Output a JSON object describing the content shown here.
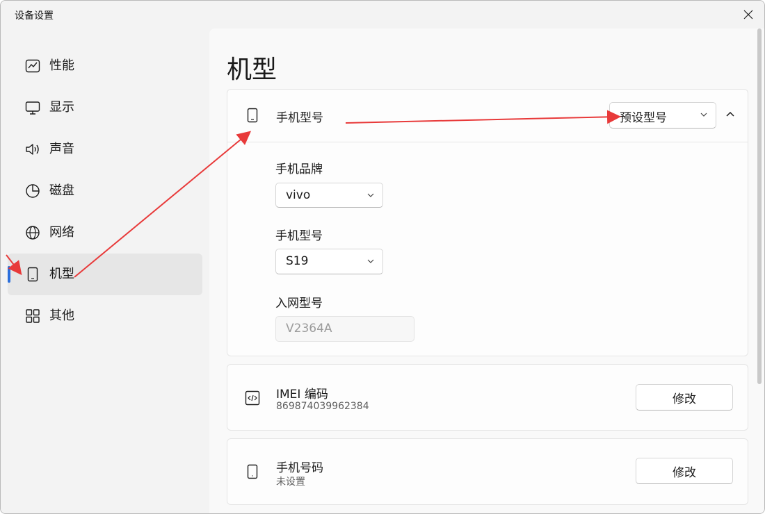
{
  "window": {
    "title": "设备设置"
  },
  "sidebar": {
    "items": [
      {
        "label": "性能",
        "icon": "chart-icon"
      },
      {
        "label": "显示",
        "icon": "monitor-icon"
      },
      {
        "label": "声音",
        "icon": "speaker-icon"
      },
      {
        "label": "磁盘",
        "icon": "pie-icon"
      },
      {
        "label": "网络",
        "icon": "globe-icon"
      },
      {
        "label": "机型",
        "icon": "phone-icon",
        "selected": true
      },
      {
        "label": "其他",
        "icon": "grid-icon"
      }
    ]
  },
  "page": {
    "title": "机型"
  },
  "model_card": {
    "title": "手机型号",
    "preset_select": "预设型号",
    "brand_label": "手机品牌",
    "brand_value": "vivo",
    "model_label": "手机型号",
    "model_value": "S19",
    "network_label": "入网型号",
    "network_value": "V2364A"
  },
  "imei_card": {
    "title": "IMEI 编码",
    "value": "869874039962384",
    "button": "修改"
  },
  "phone_card": {
    "title": "手机号码",
    "value": "未设置",
    "button": "修改"
  },
  "colors": {
    "accent": "#2b6fdc",
    "annotation_arrow": "#e83a3a"
  }
}
